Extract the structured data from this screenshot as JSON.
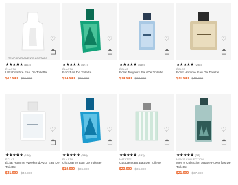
{
  "colors": {
    "sale_price": "#e8500e",
    "old_price": "#999999",
    "stars": "#1a1a1a",
    "card_bg": "#f4f4f4"
  },
  "icons": {
    "wishlist": "heart-icon",
    "cart": "shopping-bag-icon",
    "rating": "star-icon"
  },
  "products": [
    {
      "badge": "TEMPORARIAMENTE AGOTADO",
      "stars": "★★★★★",
      "reviews": "(803)",
      "brand": "ÉLASTA",
      "name": "Ultrahombre Eau De Toilette",
      "price": "$17.990",
      "old_price": "$35.990"
    },
    {
      "badge": "",
      "stars": "★★★★★",
      "reviews": "(471)",
      "brand": "ÉLASTA",
      "name": "Rockflas De Toilette",
      "price": "$14.990",
      "old_price": "$25.990"
    },
    {
      "badge": "",
      "stars": "★★★★★",
      "reviews": "(456)",
      "brand": "ÉCLAT",
      "name": "Éclat Toujours Eau De Toilette",
      "price": "$19.990",
      "old_price": "$33.990"
    },
    {
      "badge": "",
      "stars": "★★★★★",
      "reviews": "(298)",
      "brand": "ÉCLAT",
      "name": "Éclat Homme Eau De Toilette",
      "price": "$31.990",
      "old_price": "$40.990"
    },
    {
      "badge": "",
      "stars": "★★★★★",
      "reviews": "(146)",
      "brand": "ÉCLAT",
      "name": "Éclat Homme Weekend Azur Eau De Toilette",
      "price": "$31.990",
      "old_price": "$40.990"
    },
    {
      "badge": "",
      "stars": "★★★★★",
      "reviews": "(389)",
      "brand": "ÉLASTA",
      "name": "Ultrazalms Eau De Toilette",
      "price": "$19.990",
      "old_price": "$35.990"
    },
    {
      "badge": "",
      "stars": "★★★★★",
      "reviews": "(153)",
      "brand": "NATATZE",
      "name": "Gautzenzant Eau De Toilette",
      "price": "$23.990",
      "old_price": "$35.990"
    },
    {
      "badge": "",
      "stars": "★★★★★",
      "reviews": "(37)",
      "brand": "MEN'S COLLECTION",
      "name": "Men's Collection Agave Powerflas De Toilette",
      "price": "$21.990",
      "old_price": "$37.990"
    }
  ]
}
